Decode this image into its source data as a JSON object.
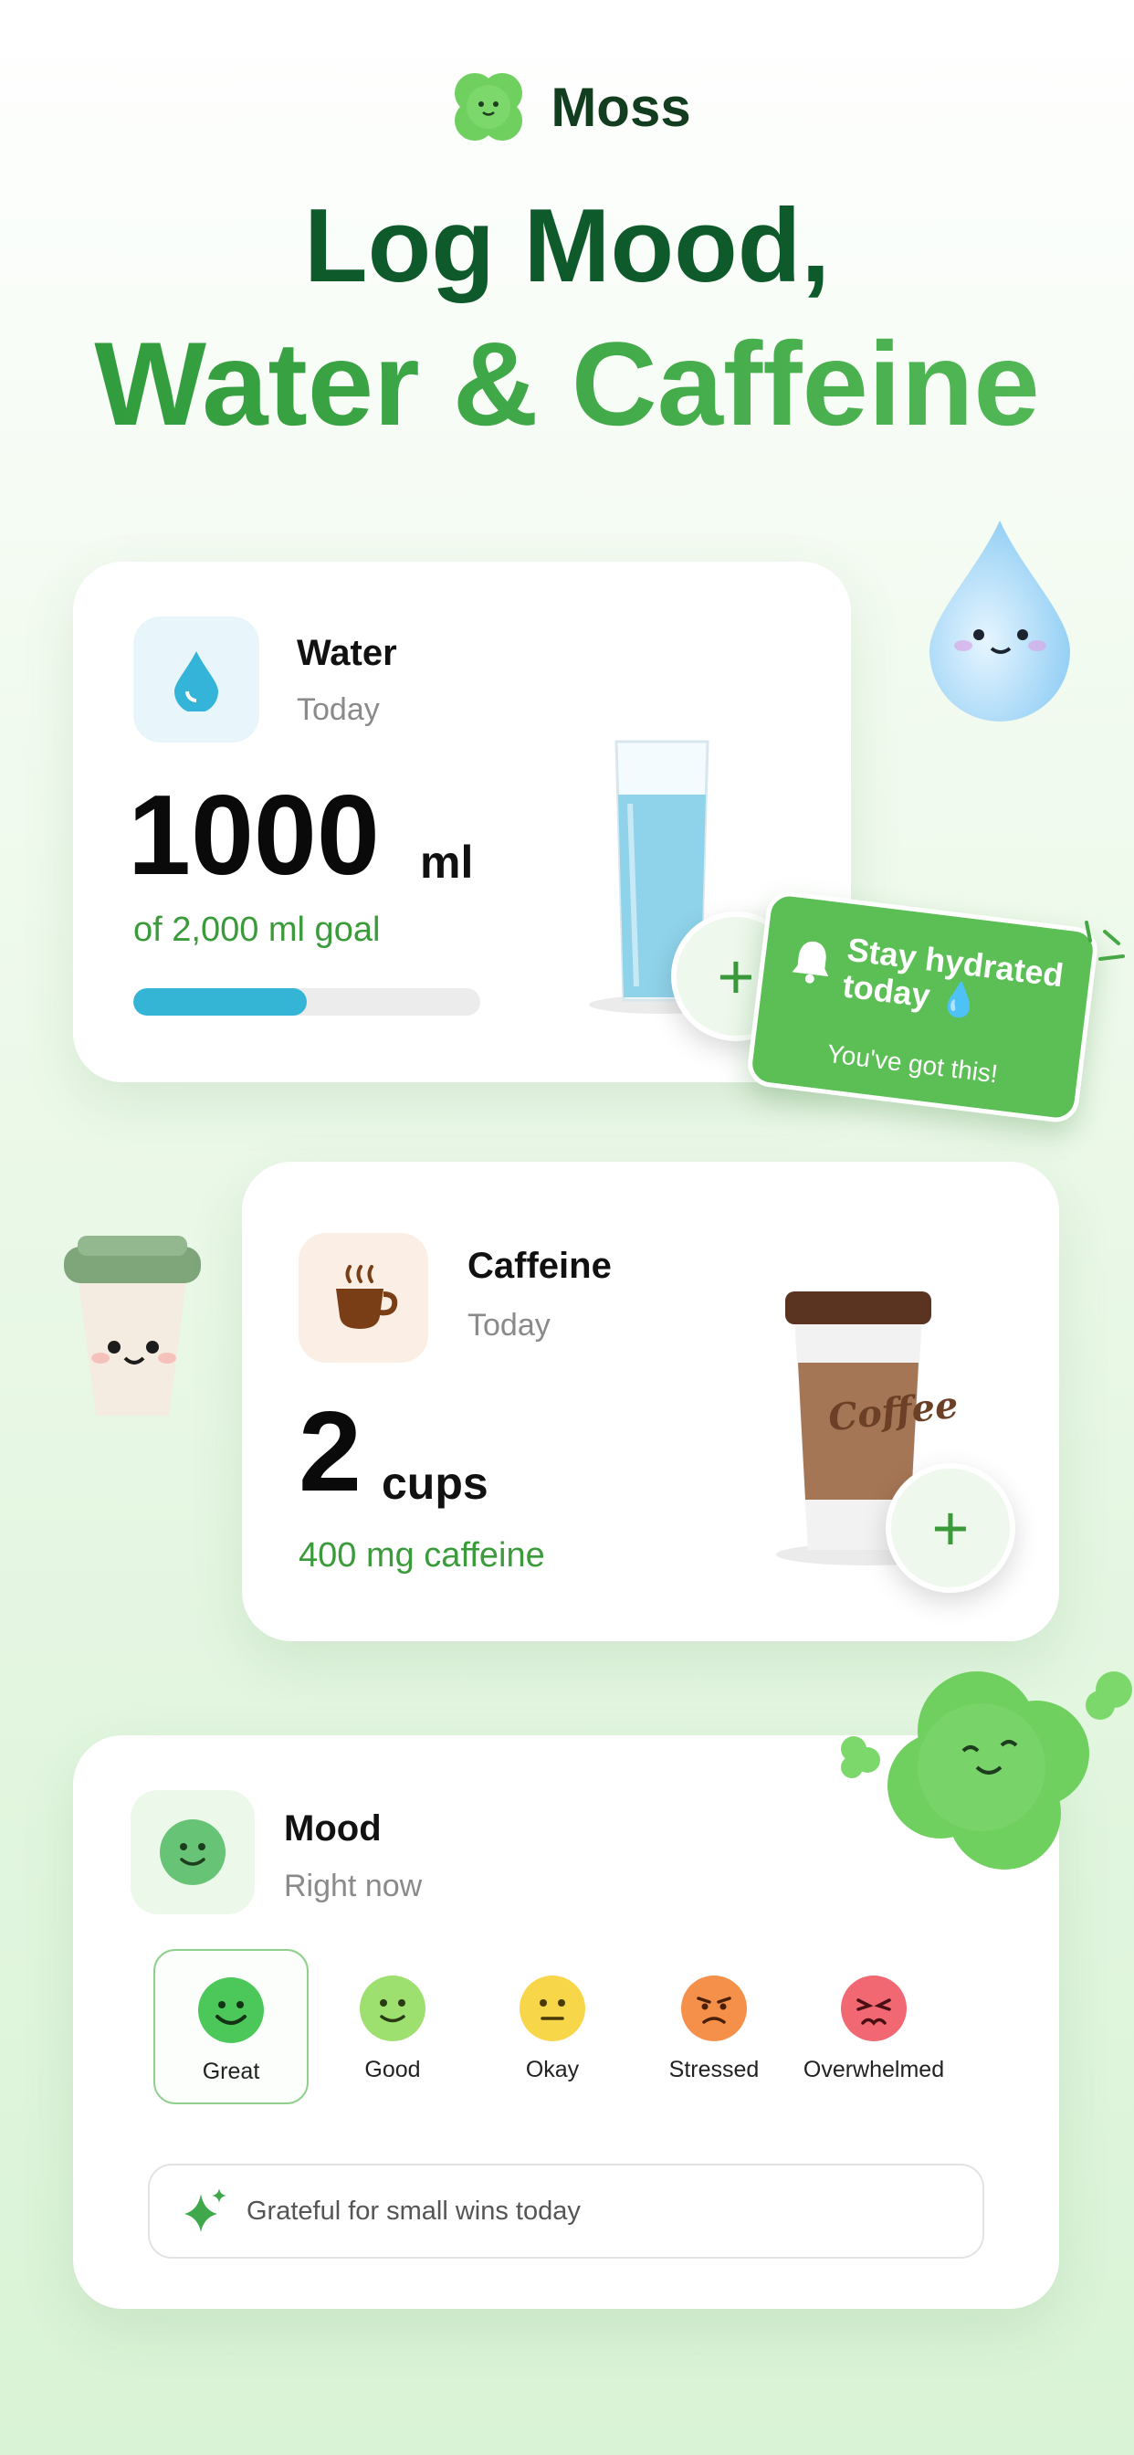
{
  "brand": {
    "name": "Moss"
  },
  "headline": {
    "line1": "Log Mood,",
    "line2": "Water & Caffeine"
  },
  "water": {
    "title": "Water",
    "subtitle": "Today",
    "amount": "1000",
    "unit": "ml",
    "goal_text": "of 2,000 ml goal",
    "progress": 0.5,
    "add_label": "+"
  },
  "toast": {
    "title": "Stay hydrated today 💧",
    "subtitle": "You've got this!"
  },
  "caffeine": {
    "title": "Caffeine",
    "subtitle": "Today",
    "amount": "2",
    "unit": "cups",
    "detail": "400 mg caffeine",
    "cup_text": "Coffee",
    "add_label": "+"
  },
  "mood": {
    "title": "Mood",
    "subtitle": "Right now",
    "options": [
      {
        "label": "Great",
        "color": "#4cc85a",
        "selected": true
      },
      {
        "label": "Good",
        "color": "#9ee070",
        "selected": false
      },
      {
        "label": "Okay",
        "color": "#f7d64a",
        "selected": false
      },
      {
        "label": "Stressed",
        "color": "#f5904a",
        "selected": false
      },
      {
        "label": "Overwhelmed",
        "color": "#f16872",
        "selected": false
      }
    ],
    "note": "Grateful for small wins today"
  },
  "colors": {
    "accent_green": "#3b9b3b",
    "water_blue": "#35b5d6",
    "brand_dark": "#0e5a2b"
  }
}
